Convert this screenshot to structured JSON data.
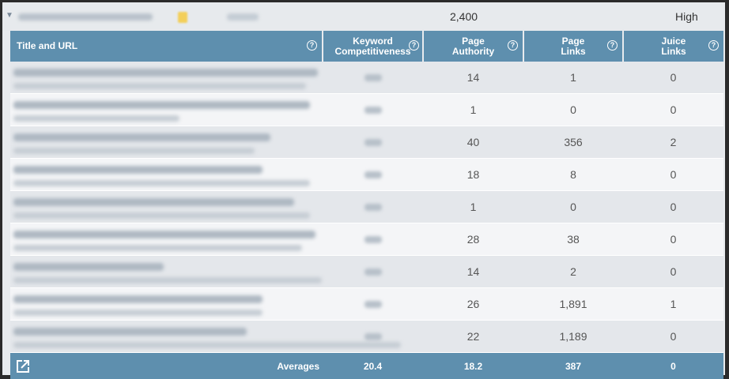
{
  "summary": {
    "search_volume": "2,400",
    "competition": "High"
  },
  "table": {
    "headers": [
      {
        "label": "Title and URL"
      },
      {
        "label": "Keyword Competitiveness"
      },
      {
        "label": "Page Authority"
      },
      {
        "label": "Page Links"
      },
      {
        "label": "Juice Links"
      }
    ],
    "rows": [
      {
        "page_authority": "14",
        "page_links": "1",
        "juice_links": "0"
      },
      {
        "page_authority": "1",
        "page_links": "0",
        "juice_links": "0"
      },
      {
        "page_authority": "40",
        "page_links": "356",
        "juice_links": "2"
      },
      {
        "page_authority": "18",
        "page_links": "8",
        "juice_links": "0"
      },
      {
        "page_authority": "1",
        "page_links": "0",
        "juice_links": "0"
      },
      {
        "page_authority": "28",
        "page_links": "38",
        "juice_links": "0"
      },
      {
        "page_authority": "14",
        "page_links": "2",
        "juice_links": "0"
      },
      {
        "page_authority": "26",
        "page_links": "1,891",
        "juice_links": "1"
      },
      {
        "page_authority": "22",
        "page_links": "1,189",
        "juice_links": "0"
      }
    ],
    "footer": {
      "label": "Averages",
      "keyword_competitiveness": "20.4",
      "page_authority": "18.2",
      "page_links": "387",
      "juice_links": "0"
    }
  },
  "icons": {
    "help": "question-circle-icon",
    "export": "export-icon",
    "expand": "caret-down-icon"
  },
  "colors": {
    "header_bg": "#5e8fae",
    "row_odd": "#e4e7eb",
    "row_even": "#f4f5f7"
  }
}
